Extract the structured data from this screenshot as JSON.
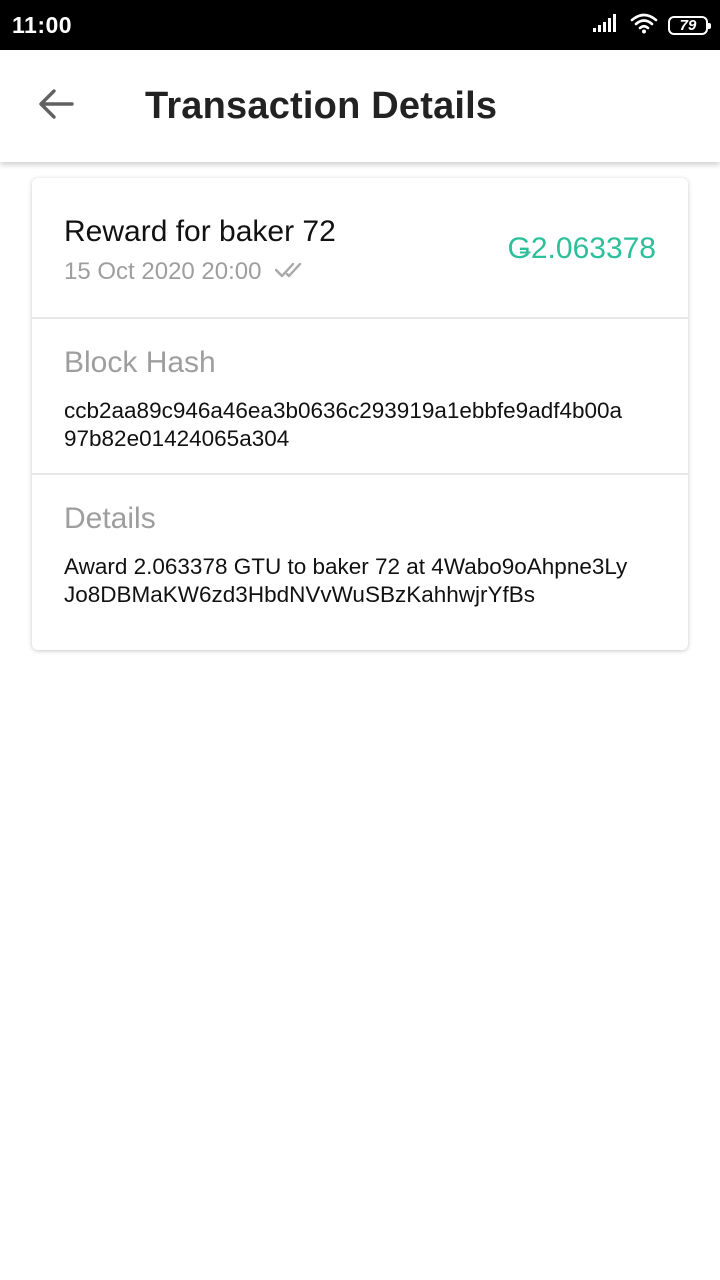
{
  "status_bar": {
    "time": "11:00",
    "battery_level": "79",
    "icons": [
      "signal-icon",
      "wifi-icon",
      "battery-icon"
    ]
  },
  "app_bar": {
    "title": "Transaction Details",
    "back_icon": "arrow-left-icon"
  },
  "transaction": {
    "title": "Reward for baker 72",
    "date": "15 Oct 2020 20:00",
    "status_icon": "double-check-icon",
    "amount": "Ǥ2.063378",
    "amount_color": "#2bbf9a"
  },
  "block_hash": {
    "label": "Block Hash",
    "line1": "ccb2aa89c946a46ea3b0636c293919a1ebbfe9adf4b00a",
    "line2": "97b82e01424065a304"
  },
  "details": {
    "label": "Details",
    "line1": "Award 2.063378 GTU to baker 72 at 4Wabo9oAhpne3Ly",
    "line2": "Jo8DBMaKW6zd3HbdNVvWuSBzKahhwjrYfBs"
  }
}
